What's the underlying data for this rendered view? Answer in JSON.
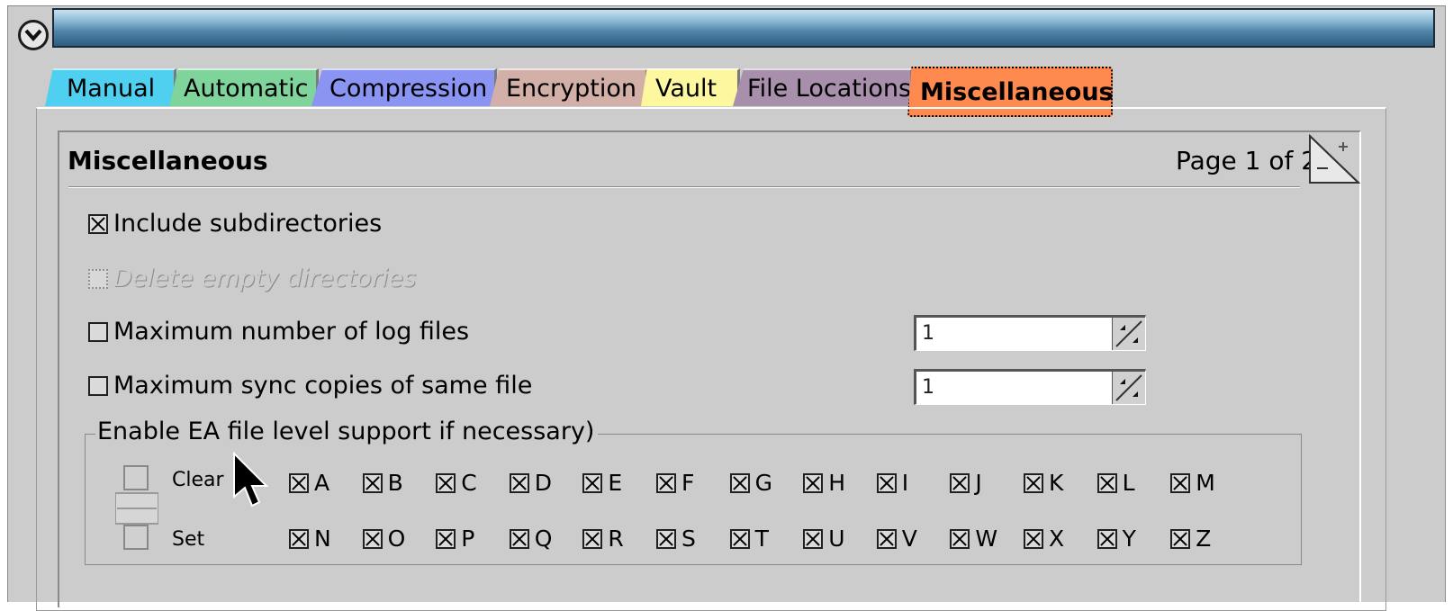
{
  "window": {
    "title": ""
  },
  "tabs": [
    {
      "label": "Manual",
      "color": "#4fd0f0",
      "active": false
    },
    {
      "label": "Automatic",
      "color": "#7ed49a",
      "active": false
    },
    {
      "label": "Compression",
      "color": "#8a94f2",
      "active": false
    },
    {
      "label": "Encryption",
      "color": "#d2b0a8",
      "active": false
    },
    {
      "label": "Vault",
      "color": "#fdf8a0",
      "active": false
    },
    {
      "label": "File Locations",
      "color": "#a890ac",
      "active": false
    },
    {
      "label": "Miscellaneous",
      "color": "#ff8a50",
      "active": true
    }
  ],
  "page": {
    "title": "Miscellaneous",
    "indicator": "Page 1 of 2"
  },
  "options": {
    "include_subdirs": {
      "label": "Include subdirectories",
      "checked": true
    },
    "delete_empty": {
      "label": "Delete empty directories",
      "checked": false,
      "disabled": true
    },
    "max_log_files": {
      "label": "Maximum number of log files",
      "checked": false,
      "value": "1"
    },
    "max_sync_copies": {
      "label": "Maximum sync copies of same file",
      "checked": false,
      "value": "1"
    }
  },
  "ea_group": {
    "label": "Enable EA file level support if necessary)",
    "clear_label": "Clear",
    "set_label": "Set",
    "drives_row1": [
      "A",
      "B",
      "C",
      "D",
      "E",
      "F",
      "G",
      "H",
      "I",
      "J",
      "K",
      "L",
      "M"
    ],
    "drives_row2": [
      "N",
      "O",
      "P",
      "Q",
      "R",
      "S",
      "T",
      "U",
      "V",
      "W",
      "X",
      "Y",
      "Z"
    ]
  }
}
